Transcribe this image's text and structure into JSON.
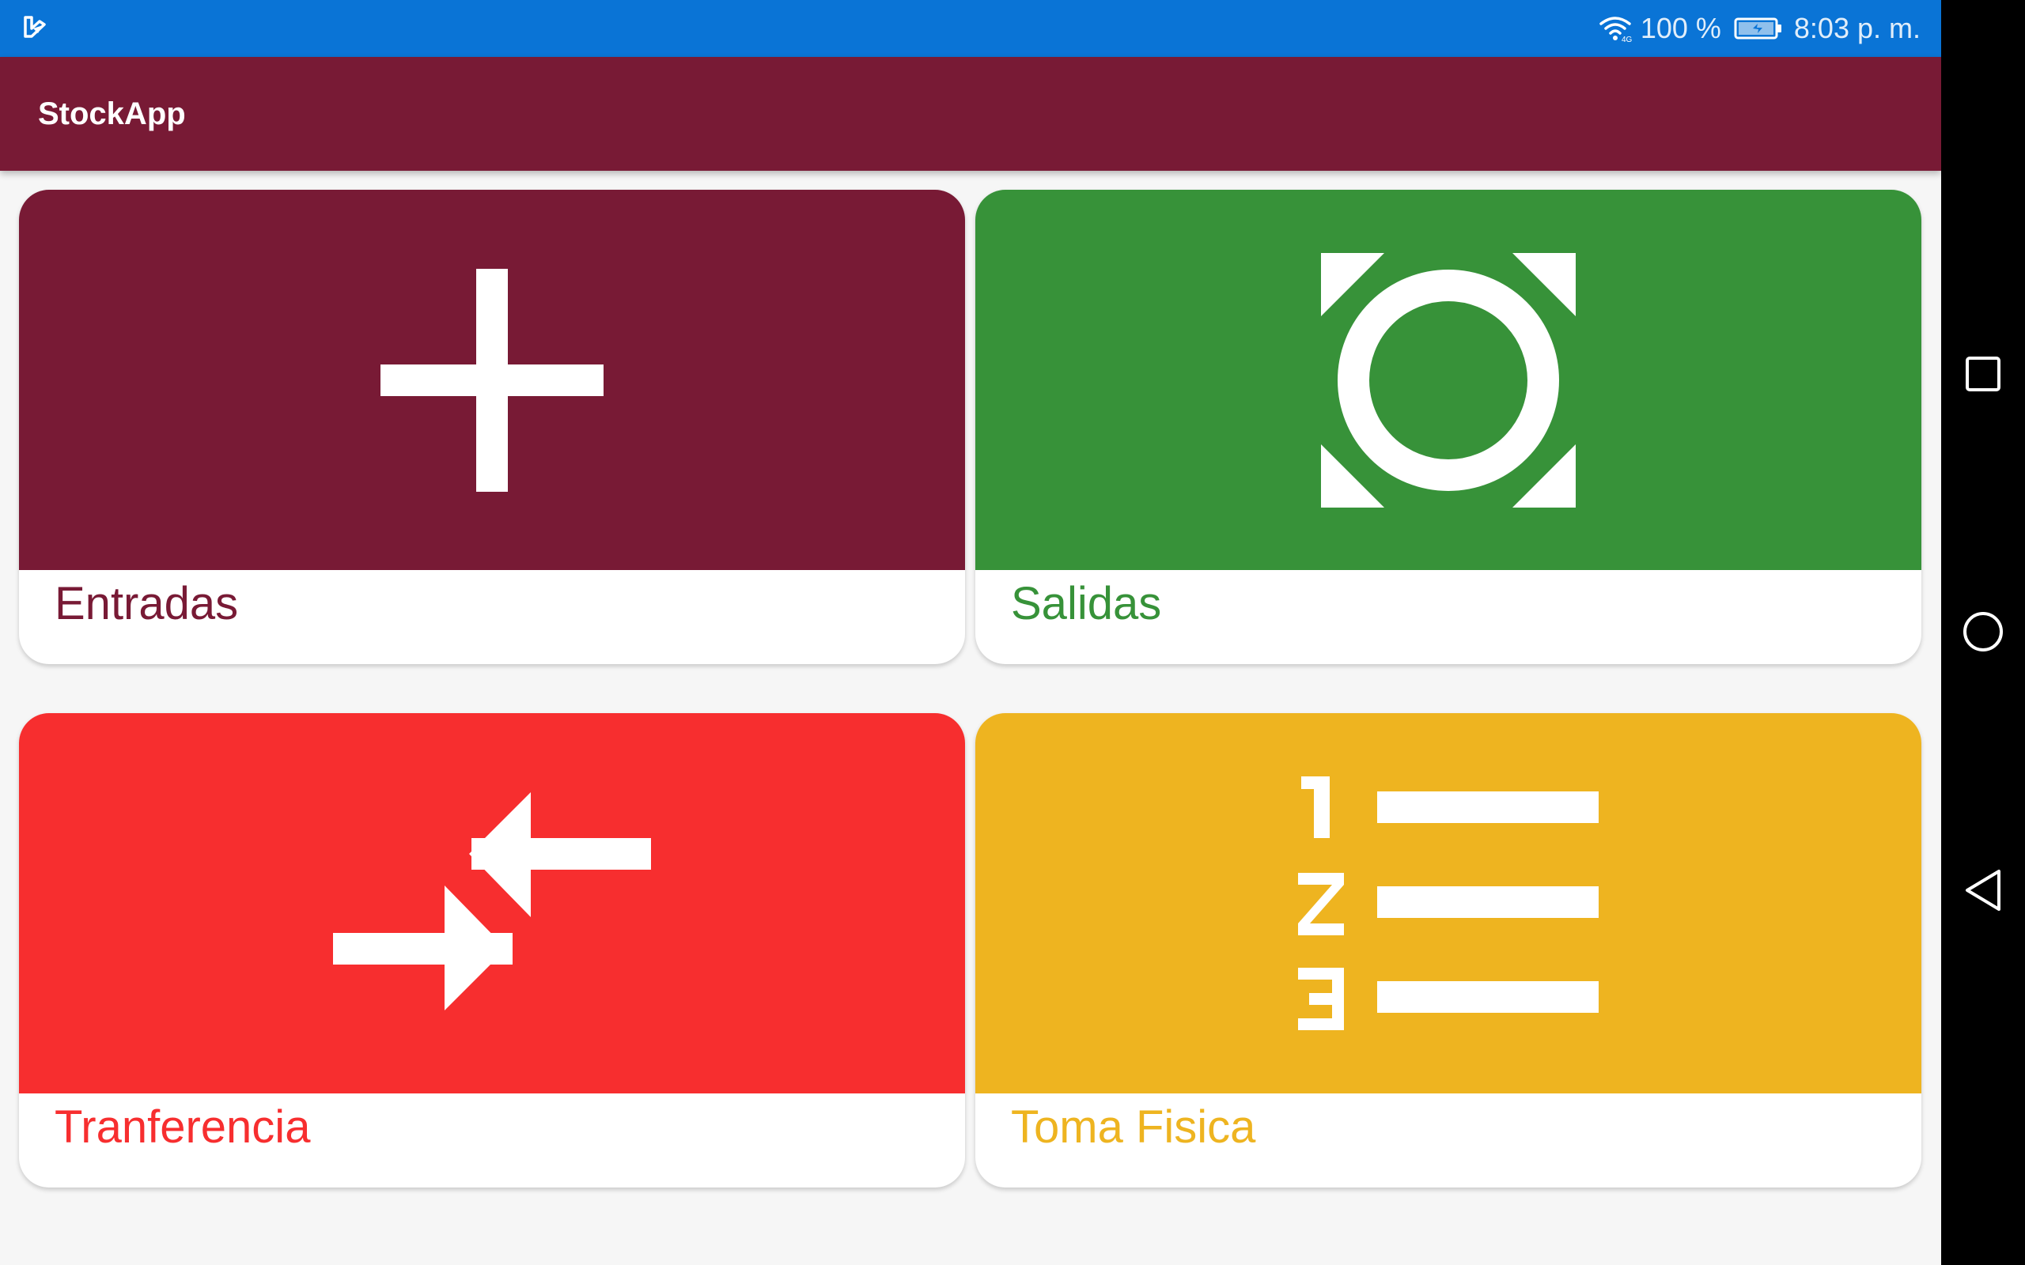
{
  "status_bar": {
    "battery_percent": "100 %",
    "time": "8:03 p. m.",
    "icons": [
      "app-notification-icon",
      "wifi-icon",
      "battery-charging-icon"
    ]
  },
  "app_bar": {
    "title": "StockApp"
  },
  "cards": [
    {
      "label": "Entradas",
      "icon": "plus-icon",
      "color": "#781a35"
    },
    {
      "label": "Salidas",
      "icon": "focus-circle-icon",
      "color": "#379239"
    },
    {
      "label": "Tranferencia",
      "icon": "transfer-arrows-icon",
      "color": "#f72e2f"
    },
    {
      "label": "Toma Fisica",
      "icon": "numbered-list-icon",
      "color": "#eeb420"
    }
  ],
  "nav_bar": {
    "buttons": [
      "recents-icon",
      "home-icon",
      "back-icon"
    ]
  }
}
